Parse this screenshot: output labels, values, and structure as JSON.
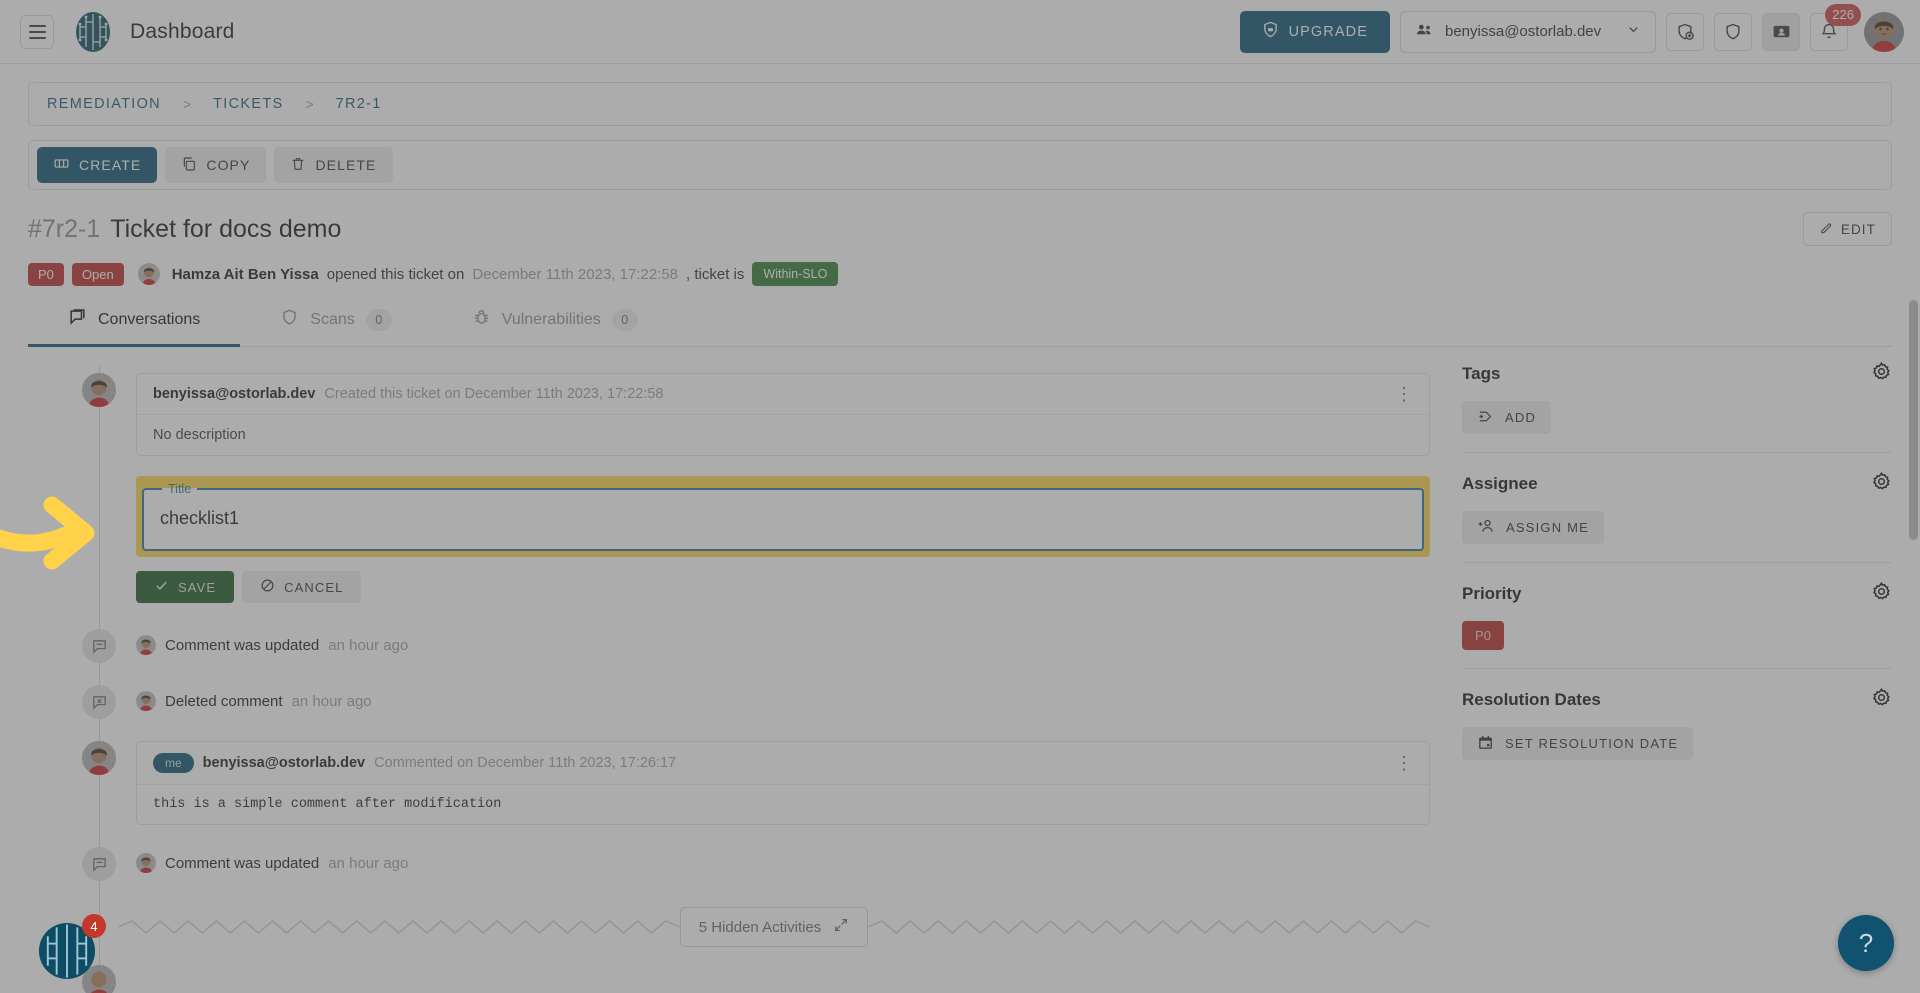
{
  "header": {
    "menu_icon": "hamburger-icon",
    "logo_icon": "ostorlab-logo-icon",
    "title": "Dashboard",
    "upgrade_label": "UPGRADE",
    "upgrade_icon": "shield-upgrade-icon",
    "org_value": "benyissa@ostorlab.dev",
    "org_icon": "group-icon",
    "org_caret": "chevron-down-icon",
    "icons": [
      {
        "name": "scan-add-icon",
        "glyph": "shield-plus"
      },
      {
        "name": "shield-icon",
        "glyph": "shield"
      },
      {
        "name": "contact-card-icon",
        "glyph": "id-card"
      },
      {
        "name": "notifications-bell-icon",
        "glyph": "bell"
      }
    ],
    "notification_count": "226",
    "avatar_alt": "user-avatar"
  },
  "breadcrumb": {
    "items": [
      "REMEDIATION",
      "TICKETS",
      "7R2-1"
    ],
    "separator": ">"
  },
  "actions": {
    "create_label": "CREATE",
    "create_icon": "ticket-icon",
    "copy_label": "COPY",
    "copy_icon": "copy-icon",
    "delete_label": "DELETE",
    "delete_icon": "trash-icon"
  },
  "ticket": {
    "ref": "#7r2-1",
    "title": "Ticket for docs demo",
    "edit_label": "EDIT",
    "edit_icon": "pencil-icon",
    "priority_badge": "P0",
    "status_badge": "Open",
    "author": "Hamza Ait Ben Yissa",
    "opened_text": "opened this ticket on",
    "opened_date": "December 11th 2023, 17:22:58",
    "ticket_is_text": ", ticket is",
    "slo_badge": "Within-SLO"
  },
  "tabs": [
    {
      "label": "Conversations",
      "icon": "conversation-icon",
      "count": null,
      "active": true
    },
    {
      "label": "Scans",
      "icon": "shield-icon",
      "count": "0",
      "active": false
    },
    {
      "label": "Vulnerabilities",
      "icon": "bug-icon",
      "count": "0",
      "active": false
    }
  ],
  "timeline": {
    "created_card": {
      "author": "benyissa@ostorlab.dev",
      "action": "Created this ticket on December 11th 2023, 17:22:58",
      "body": "No description",
      "kebab_icon": "more-vertical-icon"
    },
    "edit_form": {
      "legend": "Title",
      "value": "checklist1",
      "placeholder": "Title",
      "save_label": "SAVE",
      "save_icon": "check-icon",
      "cancel_label": "CANCEL",
      "cancel_icon": "block-icon"
    },
    "activities": [
      {
        "icon": "comment-edit-icon",
        "text": "Comment was updated",
        "time": "an hour ago"
      },
      {
        "icon": "comment-delete-icon",
        "text": "Deleted comment",
        "time": "an hour ago"
      }
    ],
    "comment_card": {
      "me_badge": "me",
      "author": "benyissa@ostorlab.dev",
      "action": "Commented on December 11th 2023, 17:26:17",
      "body": "this is a simple comment after modification",
      "kebab_icon": "more-vertical-icon"
    },
    "activity_after": {
      "icon": "comment-edit-icon",
      "text": "Comment was updated",
      "time": "an hour ago"
    },
    "hidden_activities_label": "5 Hidden Activities",
    "hidden_activities_icon": "expand-diagonal-icon"
  },
  "sidebar": {
    "sections": [
      {
        "title": "Tags",
        "gear_icon": "gear-icon",
        "button_label": "ADD",
        "button_icon": "tag-plus-icon",
        "type": "button"
      },
      {
        "title": "Assignee",
        "gear_icon": "gear-icon",
        "button_label": "ASSIGN ME",
        "button_icon": "person-add-icon",
        "type": "button"
      },
      {
        "title": "Priority",
        "gear_icon": "gear-icon",
        "chip_label": "P0",
        "type": "chip"
      },
      {
        "title": "Resolution Dates",
        "gear_icon": "gear-icon",
        "button_label": "SET RESOLUTION DATE",
        "button_icon": "calendar-icon",
        "type": "button"
      }
    ]
  },
  "floating": {
    "arrow_icon": "yellow-pointer-arrow",
    "corner_widget_icon": "ostorlab-logo-icon",
    "corner_widget_count": "4",
    "help_label": "?"
  },
  "colors": {
    "brand": "#0c5273",
    "accent_highlight": "#ffd54a",
    "danger": "#bb2d2d",
    "success": "#2e7d32",
    "field_border": "#2077a0",
    "save_green": "#1e5b26"
  }
}
